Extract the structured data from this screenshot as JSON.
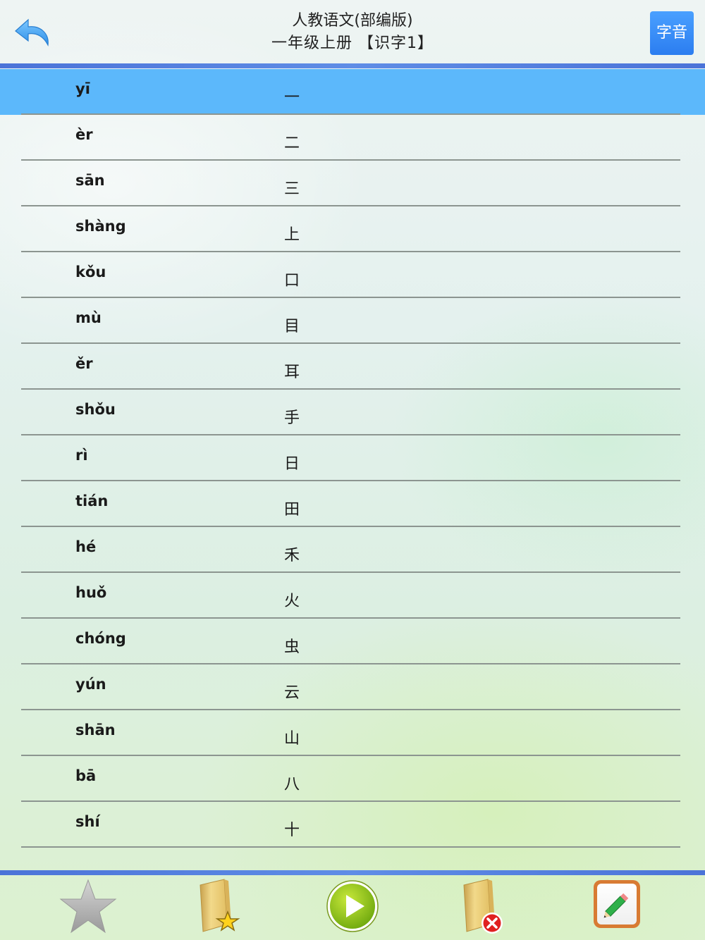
{
  "header": {
    "title_line1": "人教语文(部编版)",
    "title_line2": "一年级上册 【识字1】",
    "mode_button_label": "字音"
  },
  "accent_colors": {
    "bar": "#4b73d8",
    "selected_row": "#5cb8fb",
    "mode_button": "#2b7df0"
  },
  "words": [
    {
      "pinyin": "yī",
      "hanzi": "一"
    },
    {
      "pinyin": "èr",
      "hanzi": "二"
    },
    {
      "pinyin": "sān",
      "hanzi": "三"
    },
    {
      "pinyin": "shàng",
      "hanzi": "上"
    },
    {
      "pinyin": "kǒu",
      "hanzi": "口"
    },
    {
      "pinyin": "mù",
      "hanzi": "目"
    },
    {
      "pinyin": "ěr",
      "hanzi": "耳"
    },
    {
      "pinyin": "shǒu",
      "hanzi": "手"
    },
    {
      "pinyin": "rì",
      "hanzi": "日"
    },
    {
      "pinyin": "tián",
      "hanzi": "田"
    },
    {
      "pinyin": "hé",
      "hanzi": "禾"
    },
    {
      "pinyin": "huǒ",
      "hanzi": "火"
    },
    {
      "pinyin": "chóng",
      "hanzi": "虫"
    },
    {
      "pinyin": "yún",
      "hanzi": "云"
    },
    {
      "pinyin": "shān",
      "hanzi": "山"
    },
    {
      "pinyin": "bā",
      "hanzi": "八"
    },
    {
      "pinyin": "shí",
      "hanzi": "十"
    }
  ],
  "selected_index": 0,
  "toolbar": {
    "icons": [
      "star-icon",
      "favorites-folder-icon",
      "play-icon",
      "delete-folder-icon",
      "edit-pencil-icon"
    ]
  }
}
